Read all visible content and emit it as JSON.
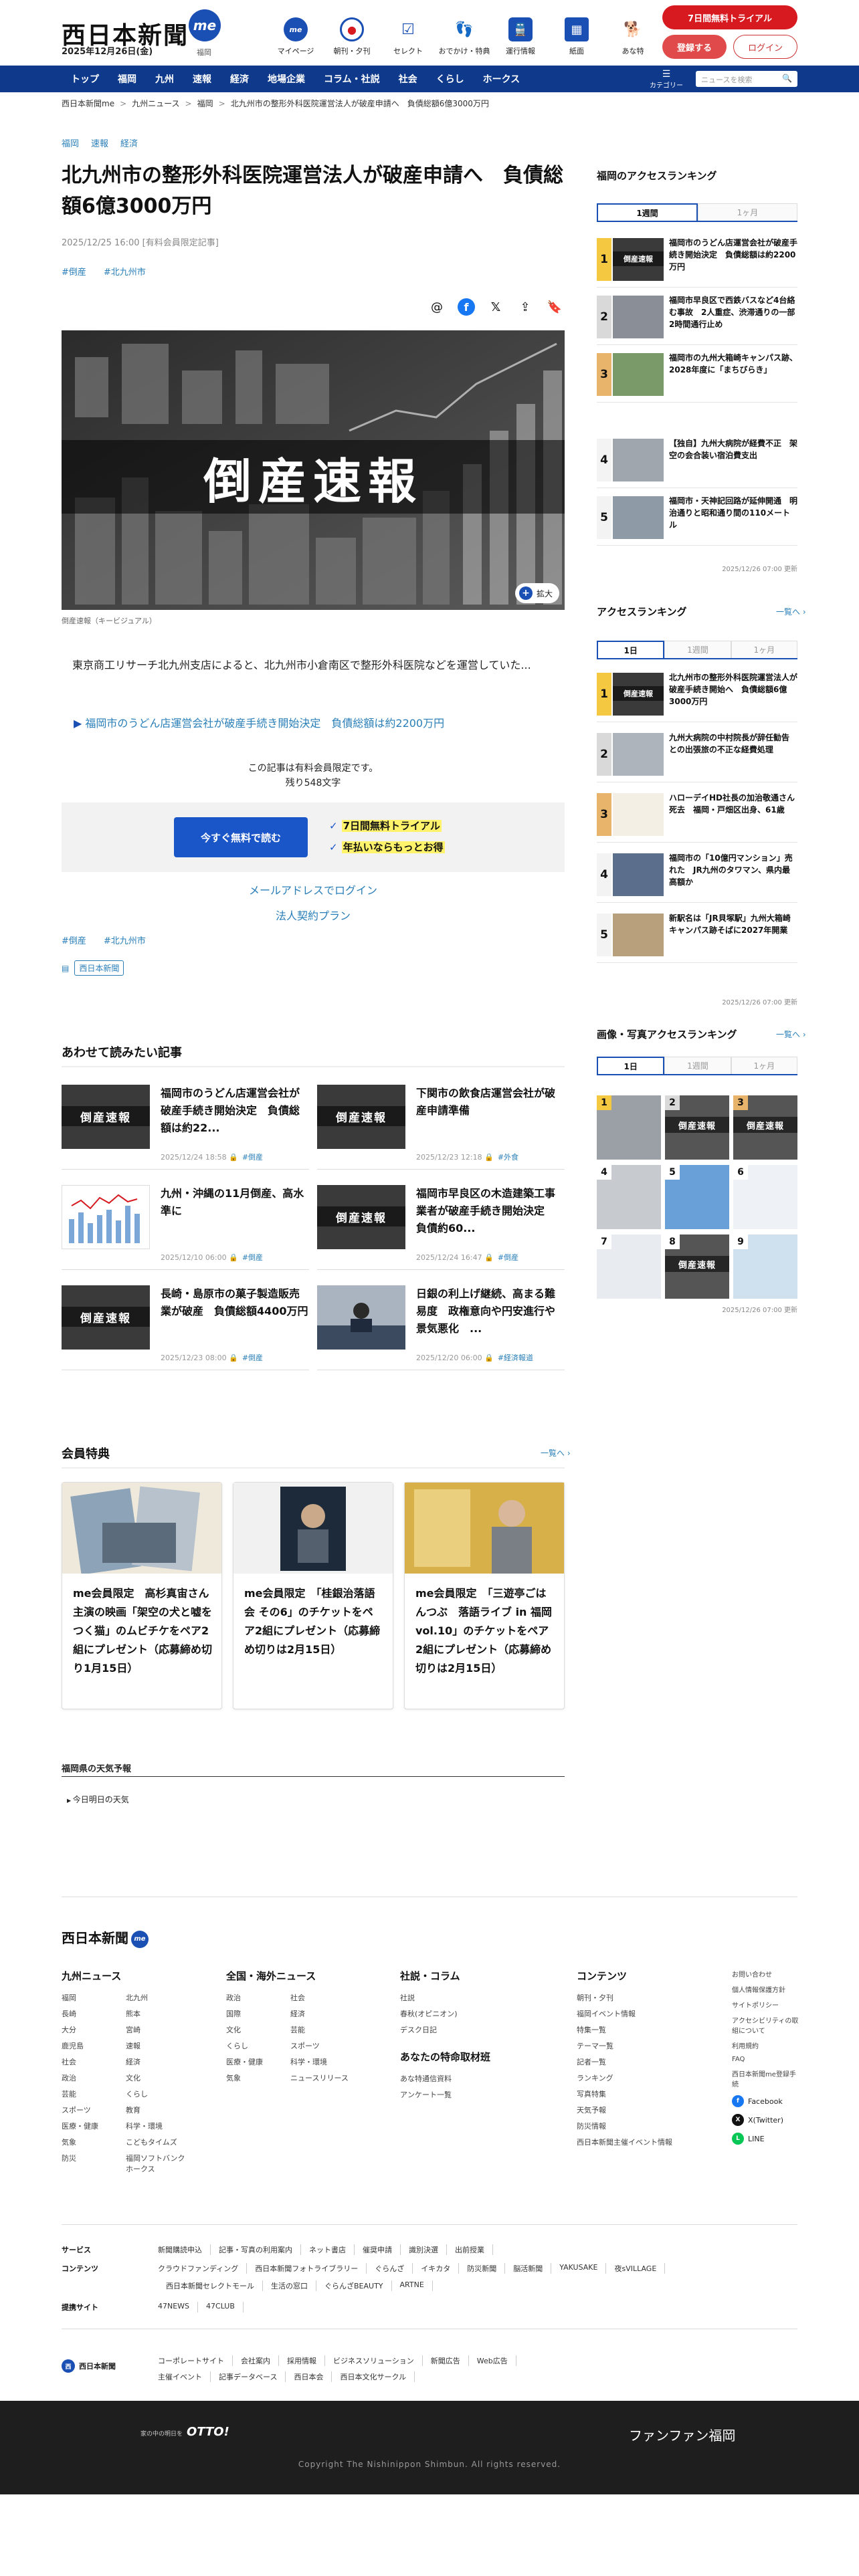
{
  "header": {
    "logo": "西日本新聞",
    "me_logo": "me",
    "date": "2025年12月26日(金)",
    "region": "福岡",
    "icons": [
      {
        "label": "マイページ",
        "icon": "me-icon"
      },
      {
        "label": "朝刊・夕刊",
        "icon": "newspaper-icon"
      },
      {
        "label": "セレクト",
        "icon": "select-icon"
      },
      {
        "label": "おでかけ・特典",
        "icon": "footprint-icon"
      },
      {
        "label": "運行情報",
        "icon": "train-icon"
      },
      {
        "label": "紙面",
        "icon": "page-icon"
      },
      {
        "label": "あな特",
        "icon": "dog-icon"
      }
    ],
    "trial_label": "7日間無料トライアル",
    "register_label": "登録する",
    "login_label": "ログイン"
  },
  "nav": {
    "items": [
      "トップ",
      "福岡",
      "九州",
      "速報",
      "経済",
      "地場企業",
      "コラム・社説",
      "社会",
      "くらし",
      "ホークス"
    ],
    "category_label": "カテゴリー",
    "search_placeholder": "ニュースを検索"
  },
  "breadcrumb": [
    "西日本新聞me",
    "九州ニュース",
    "福岡",
    "北九州市の整形外科医院運営法人が破産申請へ　負債総額6億3000万円"
  ],
  "article": {
    "top_tags": [
      "福岡",
      "速報",
      "経済"
    ],
    "title": "北九州市の整形外科医院運営法人が破産申請へ　負債総額6億3000万円",
    "date": "2025/12/25 16:00 [有料会員限定記事]",
    "hashtags": [
      "#倒産",
      "#北九州市"
    ],
    "image_text": "倒産速報",
    "zoom_label": "拡大",
    "caption": "倒産速報（キービジュアル）",
    "body": "　東京商工リサーチ北九州支店によると、北九州市小倉南区で整形外科医院などを運営していた...",
    "related_link": "福岡市のうどん店運営会社が破産手続き開始決定　負債総額は約2200万円",
    "member_note_1": "この記事は有料会員限定です。",
    "member_note_2": "残り548文字",
    "read_free_label": "今すぐ無料で読む",
    "perks": [
      "7日間無料トライアル",
      "年払いならもっとお得"
    ],
    "email_login": "メールアドレスでログイン",
    "corporate_plan": "法人契約プラン",
    "bottom_tags": [
      "#倒産",
      "#北九州市"
    ],
    "press_badge": "西日本新聞"
  },
  "recommended": {
    "heading": "あわせて読みたい記事",
    "items": [
      {
        "title": "福岡市のうどん店運営会社が破産手続き開始決定　負債総額は約22...",
        "date": "2025/12/24 18:58",
        "tag": "#倒産",
        "thumb": "倒産速報"
      },
      {
        "title": "下関市の飲食店運営会社が破産申請準備",
        "date": "2025/12/23 12:18",
        "tag": "#外食",
        "thumb": "倒産速報"
      },
      {
        "title": "九州・沖縄の11月倒産、高水準に",
        "date": "2025/12/10 06:00",
        "tag": "#倒産",
        "thumb": ""
      },
      {
        "title": "福岡市早良区の木造建築工事業者が破産手続き開始決定　負債約60...",
        "date": "2025/12/24 16:47",
        "tag": "#倒産",
        "thumb": "倒産速報"
      },
      {
        "title": "長崎・島原市の菓子製造販売業が破産　負債総額4400万円",
        "date": "2025/12/23 08:00",
        "tag": "#倒産",
        "thumb": "倒産速報"
      },
      {
        "title": "日銀の利上げ継続、高まる難易度　政権意向や円安進行や景気悪化　...",
        "date": "2025/12/20 06:00",
        "tag": "#経済報道",
        "thumb": ""
      }
    ]
  },
  "member_benefits": {
    "heading": "会員特典",
    "more": "一覧へ",
    "items": [
      {
        "title": "me会員限定　高杉真宙さん主演の映画「架空の犬と嘘をつく猫」のムビチケをペア2組にプレゼント（応募締め切り1月15日）"
      },
      {
        "title": "me会員限定　「桂銀治落語会 その6」のチケットをペア2組にプレゼント（応募締め切りは2月15日）"
      },
      {
        "title": "me会員限定　「三遊亭ごはんつぶ　落語ライブ in 福岡 vol.10」のチケットをペア2組にプレゼント（応募締め切りは2月15日）"
      }
    ]
  },
  "weather": {
    "heading": "福岡県の天気予報",
    "text": "今日明日の天気"
  },
  "sidebar": {
    "fukuoka_ranking": {
      "heading": "福岡のアクセスランキング",
      "tabs": [
        "1週間",
        "1ヶ月"
      ],
      "items": [
        "福岡市のうどん店運営会社が破産手続き開始決定　負債総額は約2200万円",
        "福岡市早良区で西鉄バスなど4台絡む事故　2人重症、渋滞通りの一部2時間通行止め",
        "福岡市の九州大箱崎キャンパス跡、2028年度に「まちびらき」",
        "【独自】九州大病院が経費不正　架空の会合装い宿泊費支出",
        "福岡市・天神記回路が延伸開通　明治通りと昭和通り間の110メートル"
      ],
      "updated": "2025/12/26 07:00 更新"
    },
    "access_ranking": {
      "heading": "アクセスランキング",
      "more": "一覧へ",
      "tabs": [
        "1日",
        "1週間",
        "1ヶ月"
      ],
      "items": [
        "北九州市の整形外科医院運営法人が破産手続き開始へ　負債総額6億3000万円",
        "九州大病院の中村院長が辞任勧告との出張旅の不正な経費処理",
        "ハローデイHD社長の加治敬通さん死去　福岡・戸畑区出身、61歳",
        "福岡市の「10億円マンション」売れた　JR九州のタワマン、県内最高額か",
        "新駅名は「JR貝塚駅」九州大箱崎キャンパス跡そばに2027年開業"
      ],
      "updated": "2025/12/26 07:00 更新"
    },
    "photo_ranking": {
      "heading": "画像・写真アクセスランキング",
      "more": "一覧へ",
      "tabs": [
        "1日",
        "1週間",
        "1ヶ月"
      ],
      "thumbs": [
        "",
        "倒産速報",
        "倒産速報",
        "",
        "",
        "",
        "",
        "倒産速報",
        ""
      ],
      "updated": "2025/12/26 07:00 更新"
    }
  },
  "footer": {
    "logo": "西日本新聞",
    "cols": [
      {
        "heading": "九州ニュース",
        "items": [
          "福岡",
          "北九州",
          "長崎",
          "熊本",
          "大分",
          "宮崎",
          "鹿児島",
          "速報",
          "社会",
          "経済",
          "政治",
          "文化",
          "芸能",
          "くらし",
          "スポーツ",
          "教育",
          "医療・健康",
          "科学・環境",
          "気象",
          "こどもタイムズ",
          "防災",
          "福岡ソフトバンクホークス"
        ]
      },
      {
        "heading": "全国・海外ニュース",
        "items": [
          "政治",
          "社会",
          "国際",
          "経済",
          "文化",
          "芸能",
          "くらし",
          "スポーツ",
          "医療・健康",
          "科学・環境",
          "気象",
          "ニュースリリース"
        ]
      },
      {
        "heading": "社説・コラム",
        "items": [
          "社説",
          "春秋(オピニオン)",
          "デスク日記"
        ],
        "heading2": "あなたの特命取材班",
        "items2": [
          "あな特通信資料",
          "アンケート一覧"
        ]
      },
      {
        "heading": "コンテンツ",
        "items": [
          "朝刊・夕刊",
          "福岡イベント情報",
          "特集一覧",
          "テーマ一覧",
          "記者一覧",
          "ランキング",
          "写真特集",
          "天気予報",
          "防災情報",
          "西日本新聞主催イベント情報"
        ]
      },
      {
        "heading": "",
        "items": [
          "お問い合わせ",
          "個人情報保護方針",
          "サイトポリシー",
          "アクセシビリティの取組について",
          "利用規約",
          "FAQ",
          "西日本新聞me登録手続"
        ],
        "sns": [
          "Facebook",
          "X(Twitter)",
          "LINE"
        ]
      }
    ],
    "service_rows": [
      {
        "label": "サービス",
        "items": [
          "新聞購読申込",
          "記事・写真の利用案内",
          "ネット書店",
          "催奨申請",
          "識別決選",
          "出前授業"
        ]
      },
      {
        "label": "コンテンツ",
        "items": [
          "クラウドファンディング",
          "西日本新聞フォトライブラリー",
          "ぐらんざ",
          "イキカタ",
          "防災新聞",
          "脳活新聞",
          "YAKUSAKE",
          "夜sVILLAGE",
          "西日本新聞セレクトモール",
          "生活の窓口",
          "ぐらんざBEAUTY",
          "ARTNE"
        ]
      },
      {
        "label": "提携サイト",
        "items": [
          "47NEWS",
          "47CLUB"
        ]
      }
    ],
    "corp_label": "西日本新聞",
    "corp_links_1": [
      "コーポレートサイト",
      "会社案内",
      "採用情報",
      "ビジネスソリューション",
      "新聞広告",
      "Web広告"
    ],
    "corp_links_2": [
      "主催イベント",
      "記事データベース",
      "西日本会",
      "西日本文化サークル"
    ],
    "otto_small": "家の中の明日を",
    "otto": "OTTO!",
    "fanfan": "ファンファン福岡",
    "copyright": "Copyright The Nishinippon Shimbun. All rights reserved."
  },
  "colors": {
    "brand": "#0f3a8c",
    "accent_red": "#d71920",
    "link": "#2a7fb8"
  }
}
